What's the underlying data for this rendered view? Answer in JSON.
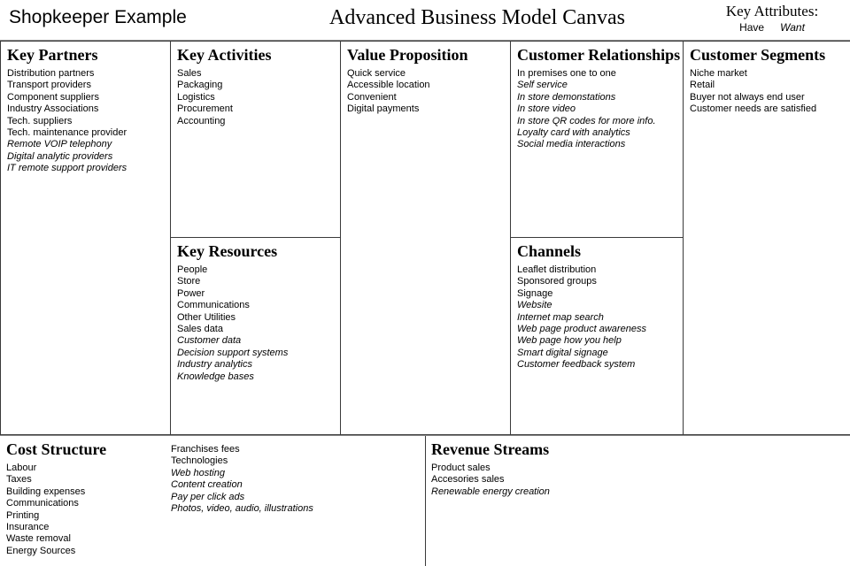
{
  "header": {
    "subject": "Shopkeeper Example",
    "title": "Advanced Business Model Canvas",
    "legend": {
      "title": "Key Attributes:",
      "have_label": "Have",
      "want_label": "Want"
    }
  },
  "blocks": {
    "key_partners": {
      "title": "Key Partners",
      "items": [
        {
          "text": "Distribution partners",
          "attribute": "have"
        },
        {
          "text": "Transport providers",
          "attribute": "have"
        },
        {
          "text": "Component suppliers",
          "attribute": "have"
        },
        {
          "text": "Industry Associations",
          "attribute": "have"
        },
        {
          "text": "Tech. suppliers",
          "attribute": "have"
        },
        {
          "text": "Tech. maintenance provider",
          "attribute": "have"
        },
        {
          "text": "Remote VOIP telephony",
          "attribute": "want"
        },
        {
          "text": "Digital analytic providers",
          "attribute": "want"
        },
        {
          "text": "IT remote support providers",
          "attribute": "want"
        }
      ]
    },
    "key_activities": {
      "title": "Key Activities",
      "items": [
        {
          "text": "Sales",
          "attribute": "have"
        },
        {
          "text": "Packaging",
          "attribute": "have"
        },
        {
          "text": "Logistics",
          "attribute": "have"
        },
        {
          "text": "Procurement",
          "attribute": "have"
        },
        {
          "text": "Accounting",
          "attribute": "have"
        }
      ]
    },
    "key_resources": {
      "title": "Key Resources",
      "items": [
        {
          "text": "People",
          "attribute": "have"
        },
        {
          "text": "Store",
          "attribute": "have"
        },
        {
          "text": "Power",
          "attribute": "have"
        },
        {
          "text": "Communications",
          "attribute": "have"
        },
        {
          "text": "Other Utilities",
          "attribute": "have"
        },
        {
          "text": "Sales data",
          "attribute": "have"
        },
        {
          "text": "Customer data",
          "attribute": "want"
        },
        {
          "text": "Decision support systems",
          "attribute": "want"
        },
        {
          "text": "Industry analytics",
          "attribute": "want"
        },
        {
          "text": "Knowledge bases",
          "attribute": "want"
        }
      ]
    },
    "value_proposition": {
      "title": "Value Proposition",
      "items": [
        {
          "text": "Quick service",
          "attribute": "have"
        },
        {
          "text": "Accessible location",
          "attribute": "have"
        },
        {
          "text": "Convenient",
          "attribute": "have"
        },
        {
          "text": "Digital payments",
          "attribute": "have"
        }
      ]
    },
    "customer_relationships": {
      "title": "Customer Relationships",
      "items": [
        {
          "text": "In premises one to one",
          "attribute": "have"
        },
        {
          "text": "Self service",
          "attribute": "want"
        },
        {
          "text": "In store demonstations",
          "attribute": "want"
        },
        {
          "text": "In store video",
          "attribute": "want"
        },
        {
          "text": "In store QR codes for more info.",
          "attribute": "want"
        },
        {
          "text": "Loyalty card with analytics",
          "attribute": "want"
        },
        {
          "text": "Social media interactions",
          "attribute": "want"
        }
      ]
    },
    "channels": {
      "title": "Channels",
      "items": [
        {
          "text": "Leaflet distribution",
          "attribute": "have"
        },
        {
          "text": "Sponsored groups",
          "attribute": "have"
        },
        {
          "text": "Signage",
          "attribute": "have"
        },
        {
          "text": "Website",
          "attribute": "want"
        },
        {
          "text": "Internet map search",
          "attribute": "want"
        },
        {
          "text": "Web page product awareness",
          "attribute": "want"
        },
        {
          "text": "Web page how you help",
          "attribute": "want"
        },
        {
          "text": "Smart digital signage",
          "attribute": "want"
        },
        {
          "text": "Customer feedback system",
          "attribute": "want"
        }
      ]
    },
    "customer_segments": {
      "title": "Customer Segments",
      "items": [
        {
          "text": "Niche market",
          "attribute": "have"
        },
        {
          "text": "Retail",
          "attribute": "have"
        },
        {
          "text": "Buyer not always end user",
          "attribute": "have"
        },
        {
          "text": "Customer needs are satisfied",
          "attribute": "have"
        }
      ]
    },
    "cost_structure": {
      "title": "Cost Structure",
      "items_left": [
        {
          "text": "Labour",
          "attribute": "have"
        },
        {
          "text": "Taxes",
          "attribute": "have"
        },
        {
          "text": "Building expenses",
          "attribute": "have"
        },
        {
          "text": "Communications",
          "attribute": "have"
        },
        {
          "text": "Printing",
          "attribute": "have"
        },
        {
          "text": "Insurance",
          "attribute": "have"
        },
        {
          "text": "Waste removal",
          "attribute": "have"
        },
        {
          "text": "Energy Sources",
          "attribute": "have"
        }
      ],
      "items_right": [
        {
          "text": "Franchises fees",
          "attribute": "have"
        },
        {
          "text": "Technologies",
          "attribute": "have"
        },
        {
          "text": "Web hosting",
          "attribute": "want"
        },
        {
          "text": "Content creation",
          "attribute": "want"
        },
        {
          "text": "Pay per click ads",
          "attribute": "want"
        },
        {
          "text": "Photos, video, audio, illustrations",
          "attribute": "want"
        }
      ]
    },
    "revenue_streams": {
      "title": "Revenue Streams",
      "items": [
        {
          "text": "Product sales",
          "attribute": "have"
        },
        {
          "text": "Accesories sales",
          "attribute": "have"
        },
        {
          "text": "Renewable energy creation",
          "attribute": "want"
        }
      ]
    }
  },
  "colors": {
    "block_border": "#3a3a3a",
    "band_border": "#8a8a8a",
    "text": "#000000",
    "background": "#ffffff"
  }
}
